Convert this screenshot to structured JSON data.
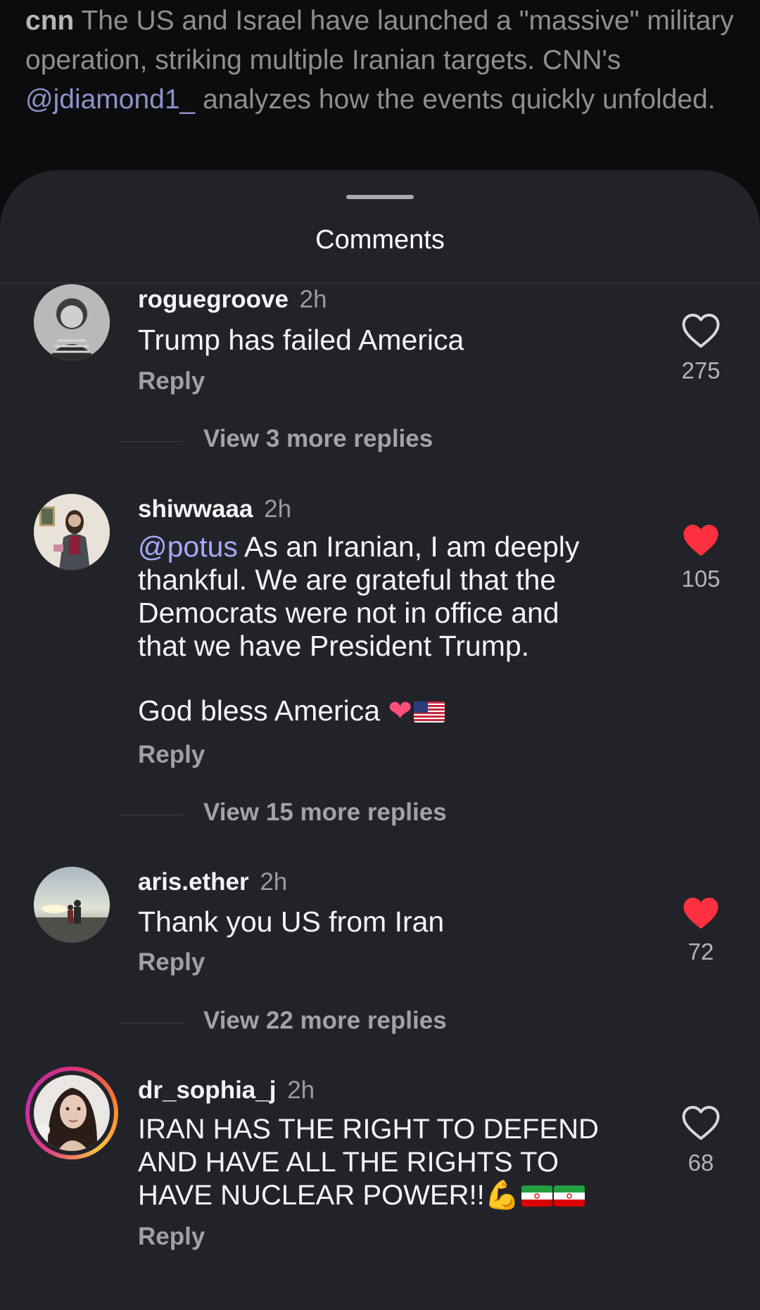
{
  "post_caption": {
    "author": "cnn",
    "text_before_mention": " The US and Israel have launched a \"massive\" military operation, striking multiple Iranian targets. CNN's ",
    "mention": "@jdiamond1_",
    "text_after_mention": " analyzes how the events quickly unfolded."
  },
  "comments_sheet": {
    "title": "Comments"
  },
  "comments": [
    {
      "username": "roguegroove",
      "time": "2h",
      "text": "Trump has failed America",
      "reply_label": "Reply",
      "like_count": "275",
      "liked": false,
      "view_replies": "View 3 more replies"
    },
    {
      "username": "shiwwaaa",
      "time": "2h",
      "mention": "@potus",
      "text": " As an Iranian, I am deeply thankful. We are grateful that the Democrats were not in office and that we have President Trump.",
      "text_line2": "God bless America",
      "emoji": "❤️🇺🇸",
      "reply_label": "Reply",
      "like_count": "105",
      "liked": true,
      "view_replies": "View 15 more replies"
    },
    {
      "username": "aris.ether",
      "time": "2h",
      "text": "Thank you US from Iran",
      "reply_label": "Reply",
      "like_count": "72",
      "liked": true,
      "view_replies": "View 22 more replies"
    },
    {
      "username": "dr_sophia_j",
      "time": "2h",
      "text": "IRAN HAS THE RIGHT TO DEFEND AND HAVE ALL THE RIGHTS TO HAVE NUCLEAR POWER!!",
      "emoji": "💪🇮🇷🇮🇷",
      "reply_label": "Reply",
      "like_count": "68",
      "liked": false
    }
  ],
  "colors": {
    "background": "#0c0c0e",
    "sheet": "#222329",
    "mention": "#a5a8f6",
    "like_red": "#ff3040",
    "muted_text": "#a0a0a6"
  },
  "icons": [
    "heart-outline-icon",
    "heart-filled-icon"
  ]
}
